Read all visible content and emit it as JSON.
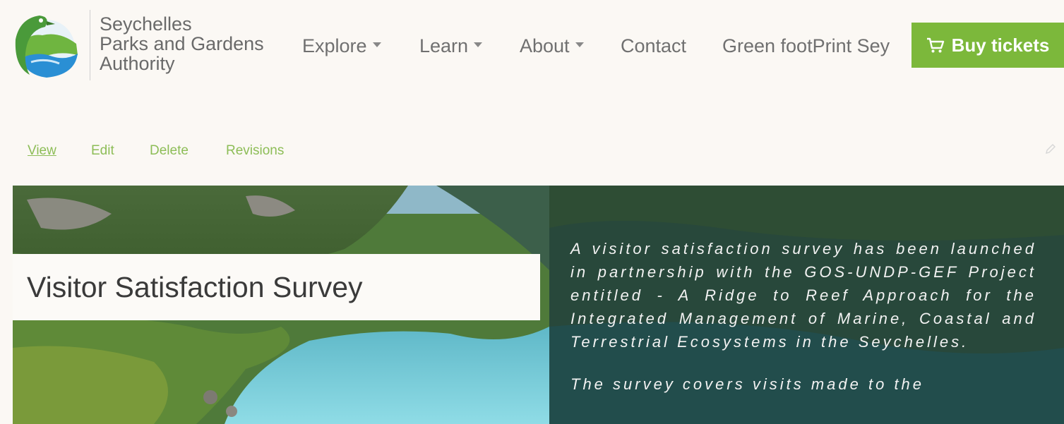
{
  "brand": {
    "line1": "Seychelles",
    "line2": "Parks and Gardens",
    "line3": "Authority"
  },
  "nav": {
    "items": [
      {
        "label": "Explore",
        "dropdown": true
      },
      {
        "label": "Learn",
        "dropdown": true
      },
      {
        "label": "About",
        "dropdown": true
      },
      {
        "label": "Contact",
        "dropdown": false
      },
      {
        "label": "Green footPrint Sey",
        "dropdown": false
      }
    ],
    "buy_label": "Buy tickets"
  },
  "tabs": {
    "items": [
      "View",
      "Edit",
      "Delete",
      "Revisions"
    ],
    "active": "View"
  },
  "hero": {
    "title": "Visitor Satisfaction Survey",
    "paragraph1": "A visitor satisfaction survey has been launched in partnership with the GOS-UNDP-GEF Project entitled - A Ridge to Reef Approach for the Integrated Management of Marine, Coastal and Terrestrial Ecosystems in the Seychelles.",
    "paragraph2": "The survey covers visits made to the"
  },
  "colors": {
    "accent": "#7cb83b",
    "link": "#8dbd57",
    "background": "#fbf8f4"
  },
  "icons": {
    "cart": "cart-icon",
    "pencil": "pencil-icon",
    "logo": "bird-logo"
  }
}
